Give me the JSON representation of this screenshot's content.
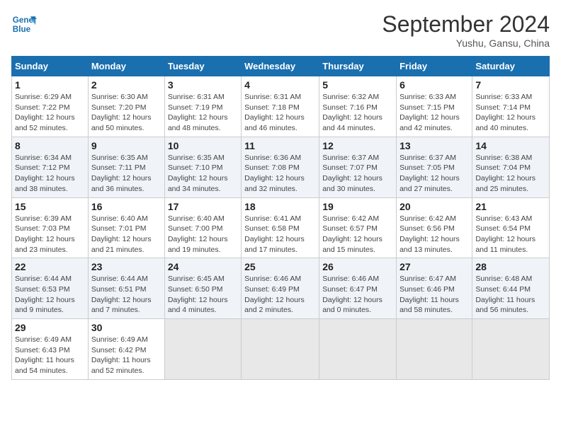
{
  "header": {
    "logo_line1": "General",
    "logo_line2": "Blue",
    "month_title": "September 2024",
    "location": "Yushu, Gansu, China"
  },
  "days_of_week": [
    "Sunday",
    "Monday",
    "Tuesday",
    "Wednesday",
    "Thursday",
    "Friday",
    "Saturday"
  ],
  "weeks": [
    [
      {
        "day": "1",
        "info": "Sunrise: 6:29 AM\nSunset: 7:22 PM\nDaylight: 12 hours\nand 52 minutes."
      },
      {
        "day": "2",
        "info": "Sunrise: 6:30 AM\nSunset: 7:20 PM\nDaylight: 12 hours\nand 50 minutes."
      },
      {
        "day": "3",
        "info": "Sunrise: 6:31 AM\nSunset: 7:19 PM\nDaylight: 12 hours\nand 48 minutes."
      },
      {
        "day": "4",
        "info": "Sunrise: 6:31 AM\nSunset: 7:18 PM\nDaylight: 12 hours\nand 46 minutes."
      },
      {
        "day": "5",
        "info": "Sunrise: 6:32 AM\nSunset: 7:16 PM\nDaylight: 12 hours\nand 44 minutes."
      },
      {
        "day": "6",
        "info": "Sunrise: 6:33 AM\nSunset: 7:15 PM\nDaylight: 12 hours\nand 42 minutes."
      },
      {
        "day": "7",
        "info": "Sunrise: 6:33 AM\nSunset: 7:14 PM\nDaylight: 12 hours\nand 40 minutes."
      }
    ],
    [
      {
        "day": "8",
        "info": "Sunrise: 6:34 AM\nSunset: 7:12 PM\nDaylight: 12 hours\nand 38 minutes."
      },
      {
        "day": "9",
        "info": "Sunrise: 6:35 AM\nSunset: 7:11 PM\nDaylight: 12 hours\nand 36 minutes."
      },
      {
        "day": "10",
        "info": "Sunrise: 6:35 AM\nSunset: 7:10 PM\nDaylight: 12 hours\nand 34 minutes."
      },
      {
        "day": "11",
        "info": "Sunrise: 6:36 AM\nSunset: 7:08 PM\nDaylight: 12 hours\nand 32 minutes."
      },
      {
        "day": "12",
        "info": "Sunrise: 6:37 AM\nSunset: 7:07 PM\nDaylight: 12 hours\nand 30 minutes."
      },
      {
        "day": "13",
        "info": "Sunrise: 6:37 AM\nSunset: 7:05 PM\nDaylight: 12 hours\nand 27 minutes."
      },
      {
        "day": "14",
        "info": "Sunrise: 6:38 AM\nSunset: 7:04 PM\nDaylight: 12 hours\nand 25 minutes."
      }
    ],
    [
      {
        "day": "15",
        "info": "Sunrise: 6:39 AM\nSunset: 7:03 PM\nDaylight: 12 hours\nand 23 minutes."
      },
      {
        "day": "16",
        "info": "Sunrise: 6:40 AM\nSunset: 7:01 PM\nDaylight: 12 hours\nand 21 minutes."
      },
      {
        "day": "17",
        "info": "Sunrise: 6:40 AM\nSunset: 7:00 PM\nDaylight: 12 hours\nand 19 minutes."
      },
      {
        "day": "18",
        "info": "Sunrise: 6:41 AM\nSunset: 6:58 PM\nDaylight: 12 hours\nand 17 minutes."
      },
      {
        "day": "19",
        "info": "Sunrise: 6:42 AM\nSunset: 6:57 PM\nDaylight: 12 hours\nand 15 minutes."
      },
      {
        "day": "20",
        "info": "Sunrise: 6:42 AM\nSunset: 6:56 PM\nDaylight: 12 hours\nand 13 minutes."
      },
      {
        "day": "21",
        "info": "Sunrise: 6:43 AM\nSunset: 6:54 PM\nDaylight: 12 hours\nand 11 minutes."
      }
    ],
    [
      {
        "day": "22",
        "info": "Sunrise: 6:44 AM\nSunset: 6:53 PM\nDaylight: 12 hours\nand 9 minutes."
      },
      {
        "day": "23",
        "info": "Sunrise: 6:44 AM\nSunset: 6:51 PM\nDaylight: 12 hours\nand 7 minutes."
      },
      {
        "day": "24",
        "info": "Sunrise: 6:45 AM\nSunset: 6:50 PM\nDaylight: 12 hours\nand 4 minutes."
      },
      {
        "day": "25",
        "info": "Sunrise: 6:46 AM\nSunset: 6:49 PM\nDaylight: 12 hours\nand 2 minutes."
      },
      {
        "day": "26",
        "info": "Sunrise: 6:46 AM\nSunset: 6:47 PM\nDaylight: 12 hours\nand 0 minutes."
      },
      {
        "day": "27",
        "info": "Sunrise: 6:47 AM\nSunset: 6:46 PM\nDaylight: 11 hours\nand 58 minutes."
      },
      {
        "day": "28",
        "info": "Sunrise: 6:48 AM\nSunset: 6:44 PM\nDaylight: 11 hours\nand 56 minutes."
      }
    ],
    [
      {
        "day": "29",
        "info": "Sunrise: 6:49 AM\nSunset: 6:43 PM\nDaylight: 11 hours\nand 54 minutes."
      },
      {
        "day": "30",
        "info": "Sunrise: 6:49 AM\nSunset: 6:42 PM\nDaylight: 11 hours\nand 52 minutes."
      },
      {
        "day": "",
        "info": ""
      },
      {
        "day": "",
        "info": ""
      },
      {
        "day": "",
        "info": ""
      },
      {
        "day": "",
        "info": ""
      },
      {
        "day": "",
        "info": ""
      }
    ]
  ]
}
